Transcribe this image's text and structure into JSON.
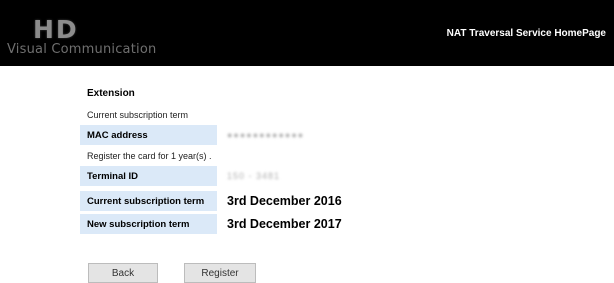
{
  "header": {
    "logo_mark": "HD",
    "logo_text": "Visual Communication",
    "home_link": "NAT Traversal Service HomePage"
  },
  "extension": {
    "title": "Extension",
    "current_term_note": "Current subscription term",
    "mac_label": "MAC address",
    "mac_value": "●●●●●●●●●●●●",
    "register_note": "Register the card for 1 year(s) .",
    "terminal_label": "Terminal ID",
    "terminal_value": "150 - 3481",
    "current_term_label": "Current subscription term",
    "current_term_value": "3rd December 2016",
    "new_term_label": "New subscription term",
    "new_term_value": "3rd December 2017"
  },
  "buttons": {
    "back": "Back",
    "register": "Register"
  }
}
